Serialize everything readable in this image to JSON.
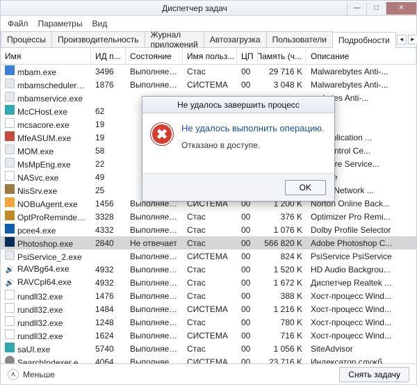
{
  "window": {
    "title": "Диспетчер задач",
    "min": "—",
    "max": "□",
    "close": "✕"
  },
  "menu": {
    "file": "Файл",
    "options": "Параметры",
    "view": "Вид"
  },
  "tabs": {
    "items": [
      {
        "label": "Процессы"
      },
      {
        "label": "Производительность"
      },
      {
        "label": "Журнал приложений"
      },
      {
        "label": "Автозагрузка"
      },
      {
        "label": "Пользователи"
      },
      {
        "label": "Подробности"
      }
    ],
    "scroll_left": "◄",
    "scroll_right": "►"
  },
  "columns": {
    "name": "Имя",
    "pid": "ИД п...",
    "state": "Состояние",
    "user": "Имя польз...",
    "cpu": "ЦП",
    "mem": "Память (ч...",
    "desc": "Описание"
  },
  "rows": [
    {
      "icon": "ico-blue",
      "name": "mbam.exe",
      "pid": "3496",
      "state": "Выполняется",
      "user": "Стас",
      "cpu": "00",
      "mem": "29 716 K",
      "desc": "Malwarebytes Anti-..."
    },
    {
      "icon": "ico-gen",
      "name": "mbamscheduler.exe",
      "pid": "1876",
      "state": "Выполняется",
      "user": "СИСТЕМА",
      "cpu": "00",
      "mem": "3 048 K",
      "desc": "Malwarebytes Anti-..."
    },
    {
      "icon": "ico-gen",
      "name": "mbamservice.exe",
      "pid": "",
      "state": "",
      "user": "",
      "cpu": "",
      "mem": "",
      "desc": "arebytes Anti-..."
    },
    {
      "icon": "ico-teal",
      "name": "McCHost.exe",
      "pid": "62",
      "state": "",
      "user": "",
      "cpu": "",
      "mem": "",
      "desc": "dvisor"
    },
    {
      "icon": "ico-doc",
      "name": "mcsacore.exe",
      "pid": "19",
      "state": "",
      "user": "",
      "cpu": "",
      "mem": "",
      "desc": "dvisor"
    },
    {
      "icon": "ico-red",
      "name": "MfeASUM.exe",
      "pid": "19",
      "state": "",
      "user": "",
      "cpu": "",
      "mem": "",
      "desc": "ee Application ..."
    },
    {
      "icon": "ico-gen",
      "name": "MOM.exe",
      "pid": "58",
      "state": "",
      "user": "",
      "cpu": "",
      "mem": "",
      "desc": "yst Control Ce..."
    },
    {
      "icon": "ico-gen",
      "name": "MsMpEng.exe",
      "pid": "22",
      "state": "",
      "user": "",
      "cpu": "",
      "mem": "",
      "desc": "malware Service..."
    },
    {
      "icon": "ico-doc",
      "name": "NASvc.exe",
      "pid": "49",
      "state": "",
      "user": "",
      "cpu": "",
      "mem": "",
      "desc": "Update"
    },
    {
      "icon": "ico-shield",
      "name": "NisSrv.exe",
      "pid": "25",
      "state": "",
      "user": "",
      "cpu": "",
      "mem": "",
      "desc": "rosoft Network ..."
    },
    {
      "icon": "ico-orange",
      "name": "NOBuAgent.exe",
      "pid": "1456",
      "state": "Выполняется",
      "user": "СИСТЕМА",
      "cpu": "00",
      "mem": "1 200 K",
      "desc": "Norton Online Back..."
    },
    {
      "icon": "ico-heye",
      "name": "OptProReminder.exe",
      "pid": "3328",
      "state": "Выполняется",
      "user": "Стас",
      "cpu": "00",
      "mem": "376 K",
      "desc": "Optimizer Pro Remi..."
    },
    {
      "icon": "ico-ah",
      "name": "pcee4.exe",
      "pid": "4332",
      "state": "Выполняется",
      "user": "Стас",
      "cpu": "00",
      "mem": "1 076 K",
      "desc": "Dolby Profile Selector"
    },
    {
      "icon": "ico-ps",
      "name": "Photoshop.exe",
      "pid": "2840",
      "state": "Не отвечает",
      "user": "Стас",
      "cpu": "00",
      "mem": "566 820 K",
      "desc": "Adobe Photoshop C...",
      "selected": true
    },
    {
      "icon": "ico-gen",
      "name": "PsiService_2.exe",
      "pid": "",
      "state": "Выполняется",
      "user": "СИСТЕМА",
      "cpu": "00",
      "mem": "824 K",
      "desc": "PsiService PsiService"
    },
    {
      "icon": "ico-speaker",
      "name": "RAVBg64.exe",
      "pid": "4932",
      "state": "Выполняется",
      "user": "Стас",
      "cpu": "00",
      "mem": "1 520 K",
      "desc": "HD Audio Backgrou..."
    },
    {
      "icon": "ico-speaker",
      "name": "RAVCpl64.exe",
      "pid": "4932",
      "state": "Выполняется",
      "user": "Стас",
      "cpu": "00",
      "mem": "1 672 K",
      "desc": "Диспетчер Realtek ..."
    },
    {
      "icon": "ico-doc",
      "name": "rundll32.exe",
      "pid": "1476",
      "state": "Выполняется",
      "user": "Стас",
      "cpu": "00",
      "mem": "388 K",
      "desc": "Хост-процесс Wind..."
    },
    {
      "icon": "ico-doc",
      "name": "rundll32.exe",
      "pid": "1484",
      "state": "Выполняется",
      "user": "СИСТЕМА",
      "cpu": "00",
      "mem": "1 216 K",
      "desc": "Хост-процесс Wind..."
    },
    {
      "icon": "ico-doc",
      "name": "rundll32.exe",
      "pid": "1248",
      "state": "Выполняется",
      "user": "Стас",
      "cpu": "00",
      "mem": "780 K",
      "desc": "Хост-процесс Wind..."
    },
    {
      "icon": "ico-doc",
      "name": "rundll32.exe",
      "pid": "1624",
      "state": "Выполняется",
      "user": "СИСТЕМА",
      "cpu": "00",
      "mem": "716 K",
      "desc": "Хост-процесс Wind..."
    },
    {
      "icon": "ico-teal",
      "name": "saUI.exe",
      "pid": "5740",
      "state": "Выполняется",
      "user": "Стас",
      "cpu": "00",
      "mem": "1 056 K",
      "desc": "SiteAdvisor"
    },
    {
      "icon": "ico-gear",
      "name": "SearchIndexer.exe",
      "pid": "4064",
      "state": "Выполняется",
      "user": "СИСТЕМА",
      "cpu": "00",
      "mem": "23 716 K",
      "desc": "Индексатор служб..."
    }
  ],
  "status": {
    "fewer": "Меньше",
    "endtask": "Снять задачу",
    "chev": "˄"
  },
  "dialog": {
    "title": "Не удалось завершить процесс",
    "message": "Не удалось выполнить операцию.",
    "sub": "Отказано в доступе.",
    "ok": "OK",
    "icon_glyph": "✖"
  }
}
